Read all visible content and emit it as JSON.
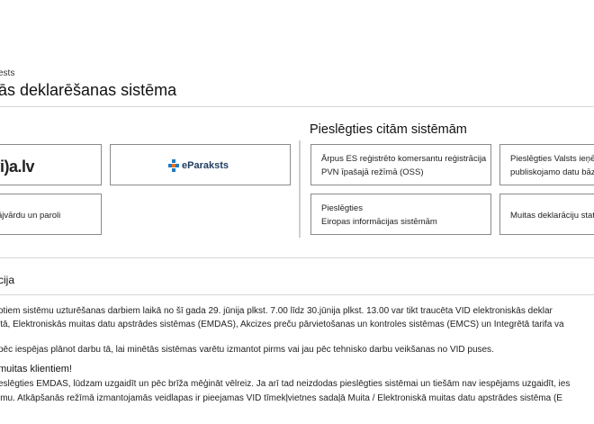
{
  "breadcrumb": "ests",
  "page_title": "ās deklarēšanas sistēma",
  "login": {
    "latvija_logo": "vi)a.lv",
    "eparaksts_label": "eParaksts",
    "password_login": "ājvārdu un paroli"
  },
  "other_systems": {
    "title": "Pieslēgties citām sistēmām",
    "cards": [
      {
        "line1": "Ārpus ES reģistrēto komersantu reģistrācija",
        "line2": "PVN īpašajā režīmā (OSS)"
      },
      {
        "line1": "Pieslēgties Valsts ieņē",
        "line2": "publiskojamo datu bāze"
      },
      {
        "line1": "Pieslēgties",
        "line2": "Eiropas informācijas sistēmām"
      },
      {
        "line1": "Muitas deklarāciju statu",
        "line2": ""
      }
    ]
  },
  "notice": {
    "title": "cija",
    "p1_line1": "otiem sistēmu uzturēšanas darbiem laikā no šī gada 29. jūnija plkst. 7.00 līdz 30.jūnija plkst. 13.00 var tikt traucēta VID elektroniskās deklar",
    "p1_line2": "itā, Elektroniskās muitas datu apstrādes sistēmas (EMDAS), Akcizes preču pārvietošanas un kontroles sistēmas (EMCS) un Integrētā tarifa va",
    "p2": "pēc iespējas plānot darbu tā, lai minētās sistēmas varētu izmantot pirms vai jau pēc tehnisko darbu veikšanas no VID puses.",
    "customs_heading": "muitas klientiem!",
    "p3_line1": "eslēgties EMDAS, lūdzam uzgaidīt un pēc brīža mēģināt vēlreiz. Ja arī tad neizdodas pieslēgties sistēmai un tiešām nav iespējams uzgaidīt, ies",
    "p3_line2": "imu. Atkāpšanās režīmā izmantojamās veidlapas ir pieejamas VID tīmekļvietnes sadaļā Muita / Elektroniskā muitas datu apstrādes sistēma (E"
  }
}
